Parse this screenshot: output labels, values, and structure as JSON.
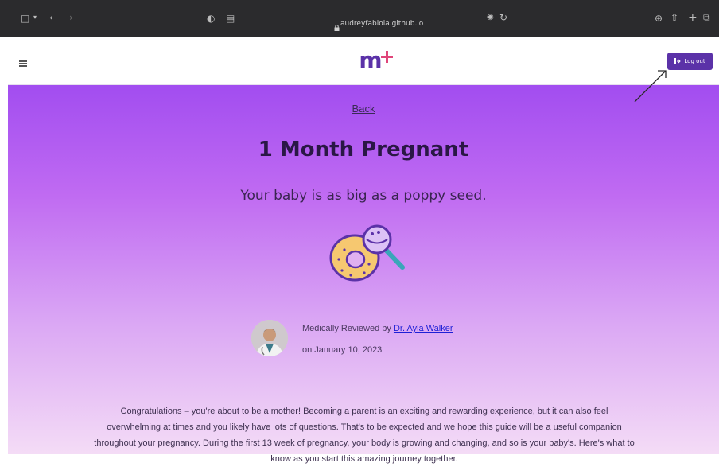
{
  "browser": {
    "url": "audreyfabiola.github.io"
  },
  "header": {
    "logo_text": "m+",
    "logout_label": "Log out"
  },
  "main": {
    "back_label": "Back",
    "title": "1 Month Pregnant",
    "subtitle": "Your baby is as big as a poppy seed.",
    "reviewer": {
      "prefix": "Medically Reviewed by ",
      "name": "Dr. Ayla Walker",
      "date": "on January 10, 2023"
    },
    "intro_paragraph": "Congratulations – you're about to be a mother! Becoming a parent is an exciting and rewarding experience, but it can also feel overwhelming at times and you likely have lots of questions. That's to be expected and we hope this guide will be a useful companion throughout your pregnancy. During the first 13 week of pregnancy, your body is growing and changing, and so is your baby's. Here's what to know as you start this amazing journey together."
  },
  "colors": {
    "brand_purple": "#5b32a8",
    "logo_plus": "#e0457a",
    "gradient_top": "#a24df0",
    "gradient_bottom": "#f4dcf6"
  }
}
